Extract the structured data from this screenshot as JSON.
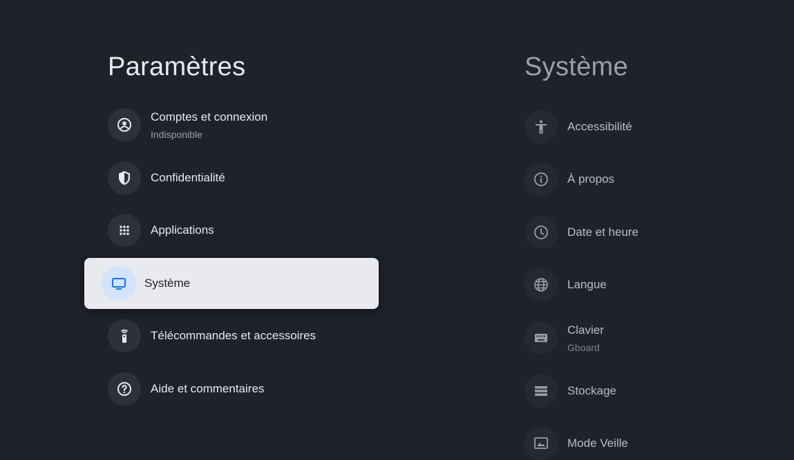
{
  "left": {
    "title": "Paramètres",
    "items": [
      {
        "label": "Comptes et connexion",
        "sub": "Indisponible",
        "icon": "account-circle-icon"
      },
      {
        "label": "Confidentialité",
        "icon": "shield-icon"
      },
      {
        "label": "Applications",
        "icon": "apps-grid-icon"
      },
      {
        "label": "Système",
        "icon": "tv-icon",
        "selected": true
      },
      {
        "label": "Télécommandes et accessoires",
        "icon": "remote-icon"
      },
      {
        "label": "Aide et commentaires",
        "icon": "help-icon"
      }
    ]
  },
  "right": {
    "title": "Système",
    "items": [
      {
        "label": "Accessibilité",
        "icon": "accessibility-icon"
      },
      {
        "label": "À propos",
        "icon": "info-icon"
      },
      {
        "label": "Date et heure",
        "icon": "clock-icon"
      },
      {
        "label": "Langue",
        "icon": "globe-icon"
      },
      {
        "label": "Clavier",
        "sub": "Gboard",
        "icon": "keyboard-icon"
      },
      {
        "label": "Stockage",
        "icon": "storage-icon"
      },
      {
        "label": "Mode Veille",
        "icon": "ambient-mode-icon"
      }
    ]
  },
  "colors": {
    "background": "#1f222a",
    "selected_background": "#e8eaef",
    "selected_icon_background": "#d2e3fc",
    "accent": "#1a73e8"
  }
}
